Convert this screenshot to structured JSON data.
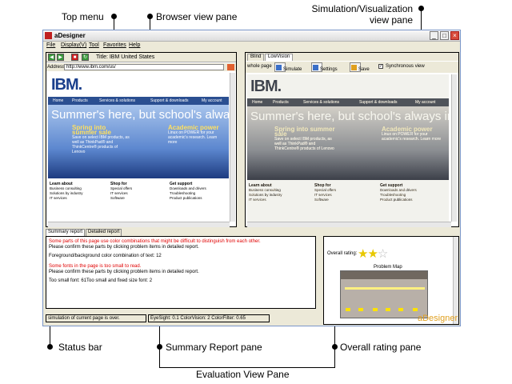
{
  "callouts": {
    "top_menu": "Top menu",
    "browser_view": "Browser view pane",
    "sim_view_line1": "Simulation/Visualization",
    "sim_view_line2": "view pane",
    "status_bar": "Status bar",
    "summary_report": "Summary Report pane",
    "overall_rating": "Overall rating pane",
    "evaluation_view": "Evaluation View Pane"
  },
  "window": {
    "title": "aDesigner",
    "controls": [
      "_",
      "□",
      "×"
    ]
  },
  "menu": [
    "File",
    "Display(V)",
    "Tool",
    "Favorites",
    "Help"
  ],
  "browser": {
    "page_title": "Title: IBM United States",
    "address_label": "Address",
    "address": "http://www.ibm.com/us/",
    "page": {
      "logo": "IBM.",
      "nav": [
        "Home",
        "Products",
        "Services & solutions",
        "Support & downloads",
        "My account"
      ],
      "hero": "Summer's here, but school's always in",
      "promo1_title": "Spring into summer sale",
      "promo1_text": "Save on select IBM products, as well as ThinkPad® and ThinkCentre® products of Lenovo",
      "promo2_title": "Academic power",
      "promo2_text": "Linux on POWER for your academic's research. Learn more",
      "col1_title": "Learn about",
      "col1_items": [
        "Business consulting",
        "Solutions by industry",
        "IT services"
      ],
      "col2_title": "Shop for",
      "col2_items": [
        "Special offers",
        "IT services",
        "Software"
      ],
      "col3_title": "Get support",
      "col3_items": [
        "Downloads and drivers",
        "Troubleshooting",
        "Product publications"
      ]
    }
  },
  "simulation": {
    "tabs": [
      "Blind",
      "LowVision"
    ],
    "toolbar": {
      "whole_page": "whole page",
      "simulate": "Simulate",
      "settings": "Settings",
      "save": "Save",
      "sync": "Synchronous view",
      "sync_checked": true
    }
  },
  "evaluation": {
    "tabs": [
      "Summary report",
      "Detailed report"
    ],
    "summary": {
      "line1": "Some parts of this page use color combinations that might be difficult to distinguish from each other.",
      "line2": "Please confirm these parts by clicking problem items in detailed report.",
      "line3": "Foreground/background color combination of text: 12",
      "line4": "Some fonts in the page is too small to read.",
      "line5": "Please confirm these parts by clicking problem items in detailed report.",
      "line6": "Too small font: 61Too small and fixed size font: 2"
    },
    "rating": {
      "label": "Overall rating:",
      "stars": 2,
      "max_stars": 3,
      "map_title": "Problem Map"
    }
  },
  "status": {
    "message": "simulation of current page is over.",
    "params": "EyeSight: 0.1  ColorVision: 2  ColorFilter: 0.65"
  },
  "brand": "aDesigner",
  "colors": {
    "ibm_blue": "#1a3f8c",
    "error_red": "#e00000",
    "star_gold": "#e8c800",
    "brand_orange": "#e0a020"
  }
}
